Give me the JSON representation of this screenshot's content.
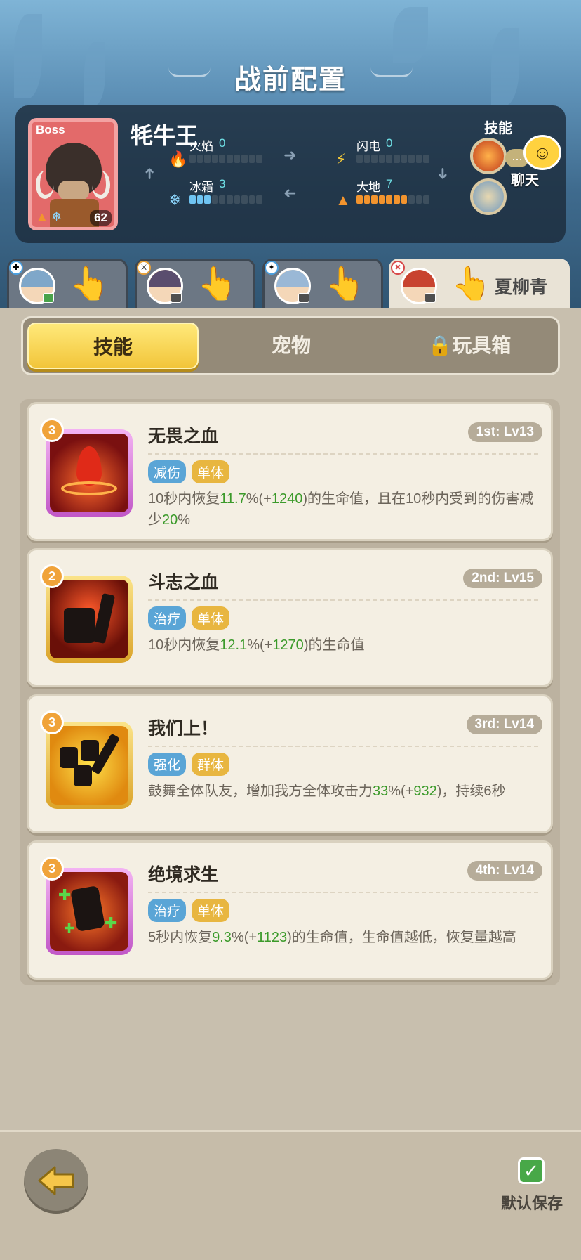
{
  "page_title": "战前配置",
  "boss": {
    "tag": "Boss",
    "name": "牦牛王",
    "level": "62",
    "stats": [
      {
        "label": "火焰",
        "value": "0",
        "fill": 0,
        "color": "#e74a36"
      },
      {
        "label": "闪电",
        "value": "0",
        "fill": 0,
        "color": "#f2c83a"
      },
      {
        "label": "冰霜",
        "value": "3",
        "fill": 3,
        "color": "#6fc4f2"
      },
      {
        "label": "大地",
        "value": "7",
        "fill": 7,
        "color": "#f2942e"
      }
    ],
    "skills_label": "技能"
  },
  "chat": {
    "label": "聊天",
    "dots": "..."
  },
  "hero_tabs": [
    {
      "name": "",
      "active": false
    },
    {
      "name": "",
      "active": false
    },
    {
      "name": "",
      "active": false
    },
    {
      "name": "夏柳青",
      "active": true
    }
  ],
  "tabs": [
    {
      "label": "技能",
      "active": true,
      "locked": false
    },
    {
      "label": "宠物",
      "active": false,
      "locked": false
    },
    {
      "label": "玩具箱",
      "active": false,
      "locked": true
    }
  ],
  "skills": [
    {
      "name": "无畏之血",
      "order": "1st: Lv13",
      "star": "3",
      "frame": "purple",
      "tags": [
        {
          "text": "减伤",
          "color": "blue"
        },
        {
          "text": "单体",
          "color": "yellow"
        }
      ],
      "desc": [
        {
          "t": "10秒内恢复"
        },
        {
          "t": "11.7",
          "g": true
        },
        {
          "t": "%(+"
        },
        {
          "t": "1240",
          "g": true
        },
        {
          "t": ")的生命值，且在10秒内受到的伤害减少"
        },
        {
          "t": "20",
          "g": true
        },
        {
          "t": "%"
        }
      ]
    },
    {
      "name": "斗志之血",
      "order": "2nd: Lv15",
      "star": "2",
      "frame": "gold",
      "tags": [
        {
          "text": "治疗",
          "color": "blue"
        },
        {
          "text": "单体",
          "color": "yellow"
        }
      ],
      "desc": [
        {
          "t": "10秒内恢复"
        },
        {
          "t": "12.1",
          "g": true
        },
        {
          "t": "%(+"
        },
        {
          "t": "1270",
          "g": true
        },
        {
          "t": ")的生命值"
        }
      ]
    },
    {
      "name": "我们上！",
      "order": "3rd: Lv14",
      "star": "3",
      "frame": "gold",
      "tags": [
        {
          "text": "强化",
          "color": "blue"
        },
        {
          "text": "群体",
          "color": "yellow"
        }
      ],
      "desc": [
        {
          "t": "鼓舞全体队友，增加我方全体攻击力"
        },
        {
          "t": "33",
          "g": true
        },
        {
          "t": "%(+"
        },
        {
          "t": "932",
          "g": true
        },
        {
          "t": ")，持续6秒"
        }
      ]
    },
    {
      "name": "绝境求生",
      "order": "4th: Lv14",
      "star": "3",
      "frame": "purple",
      "tags": [
        {
          "text": "治疗",
          "color": "blue"
        },
        {
          "text": "单体",
          "color": "yellow"
        }
      ],
      "desc": [
        {
          "t": "5秒内恢复"
        },
        {
          "t": "9.3",
          "g": true
        },
        {
          "t": "%(+"
        },
        {
          "t": "1123",
          "g": true
        },
        {
          "t": ")的生命值，生命值越低，恢复量越高"
        }
      ]
    }
  ],
  "bottom": {
    "save_label": "默认保存",
    "save_checked": true
  }
}
